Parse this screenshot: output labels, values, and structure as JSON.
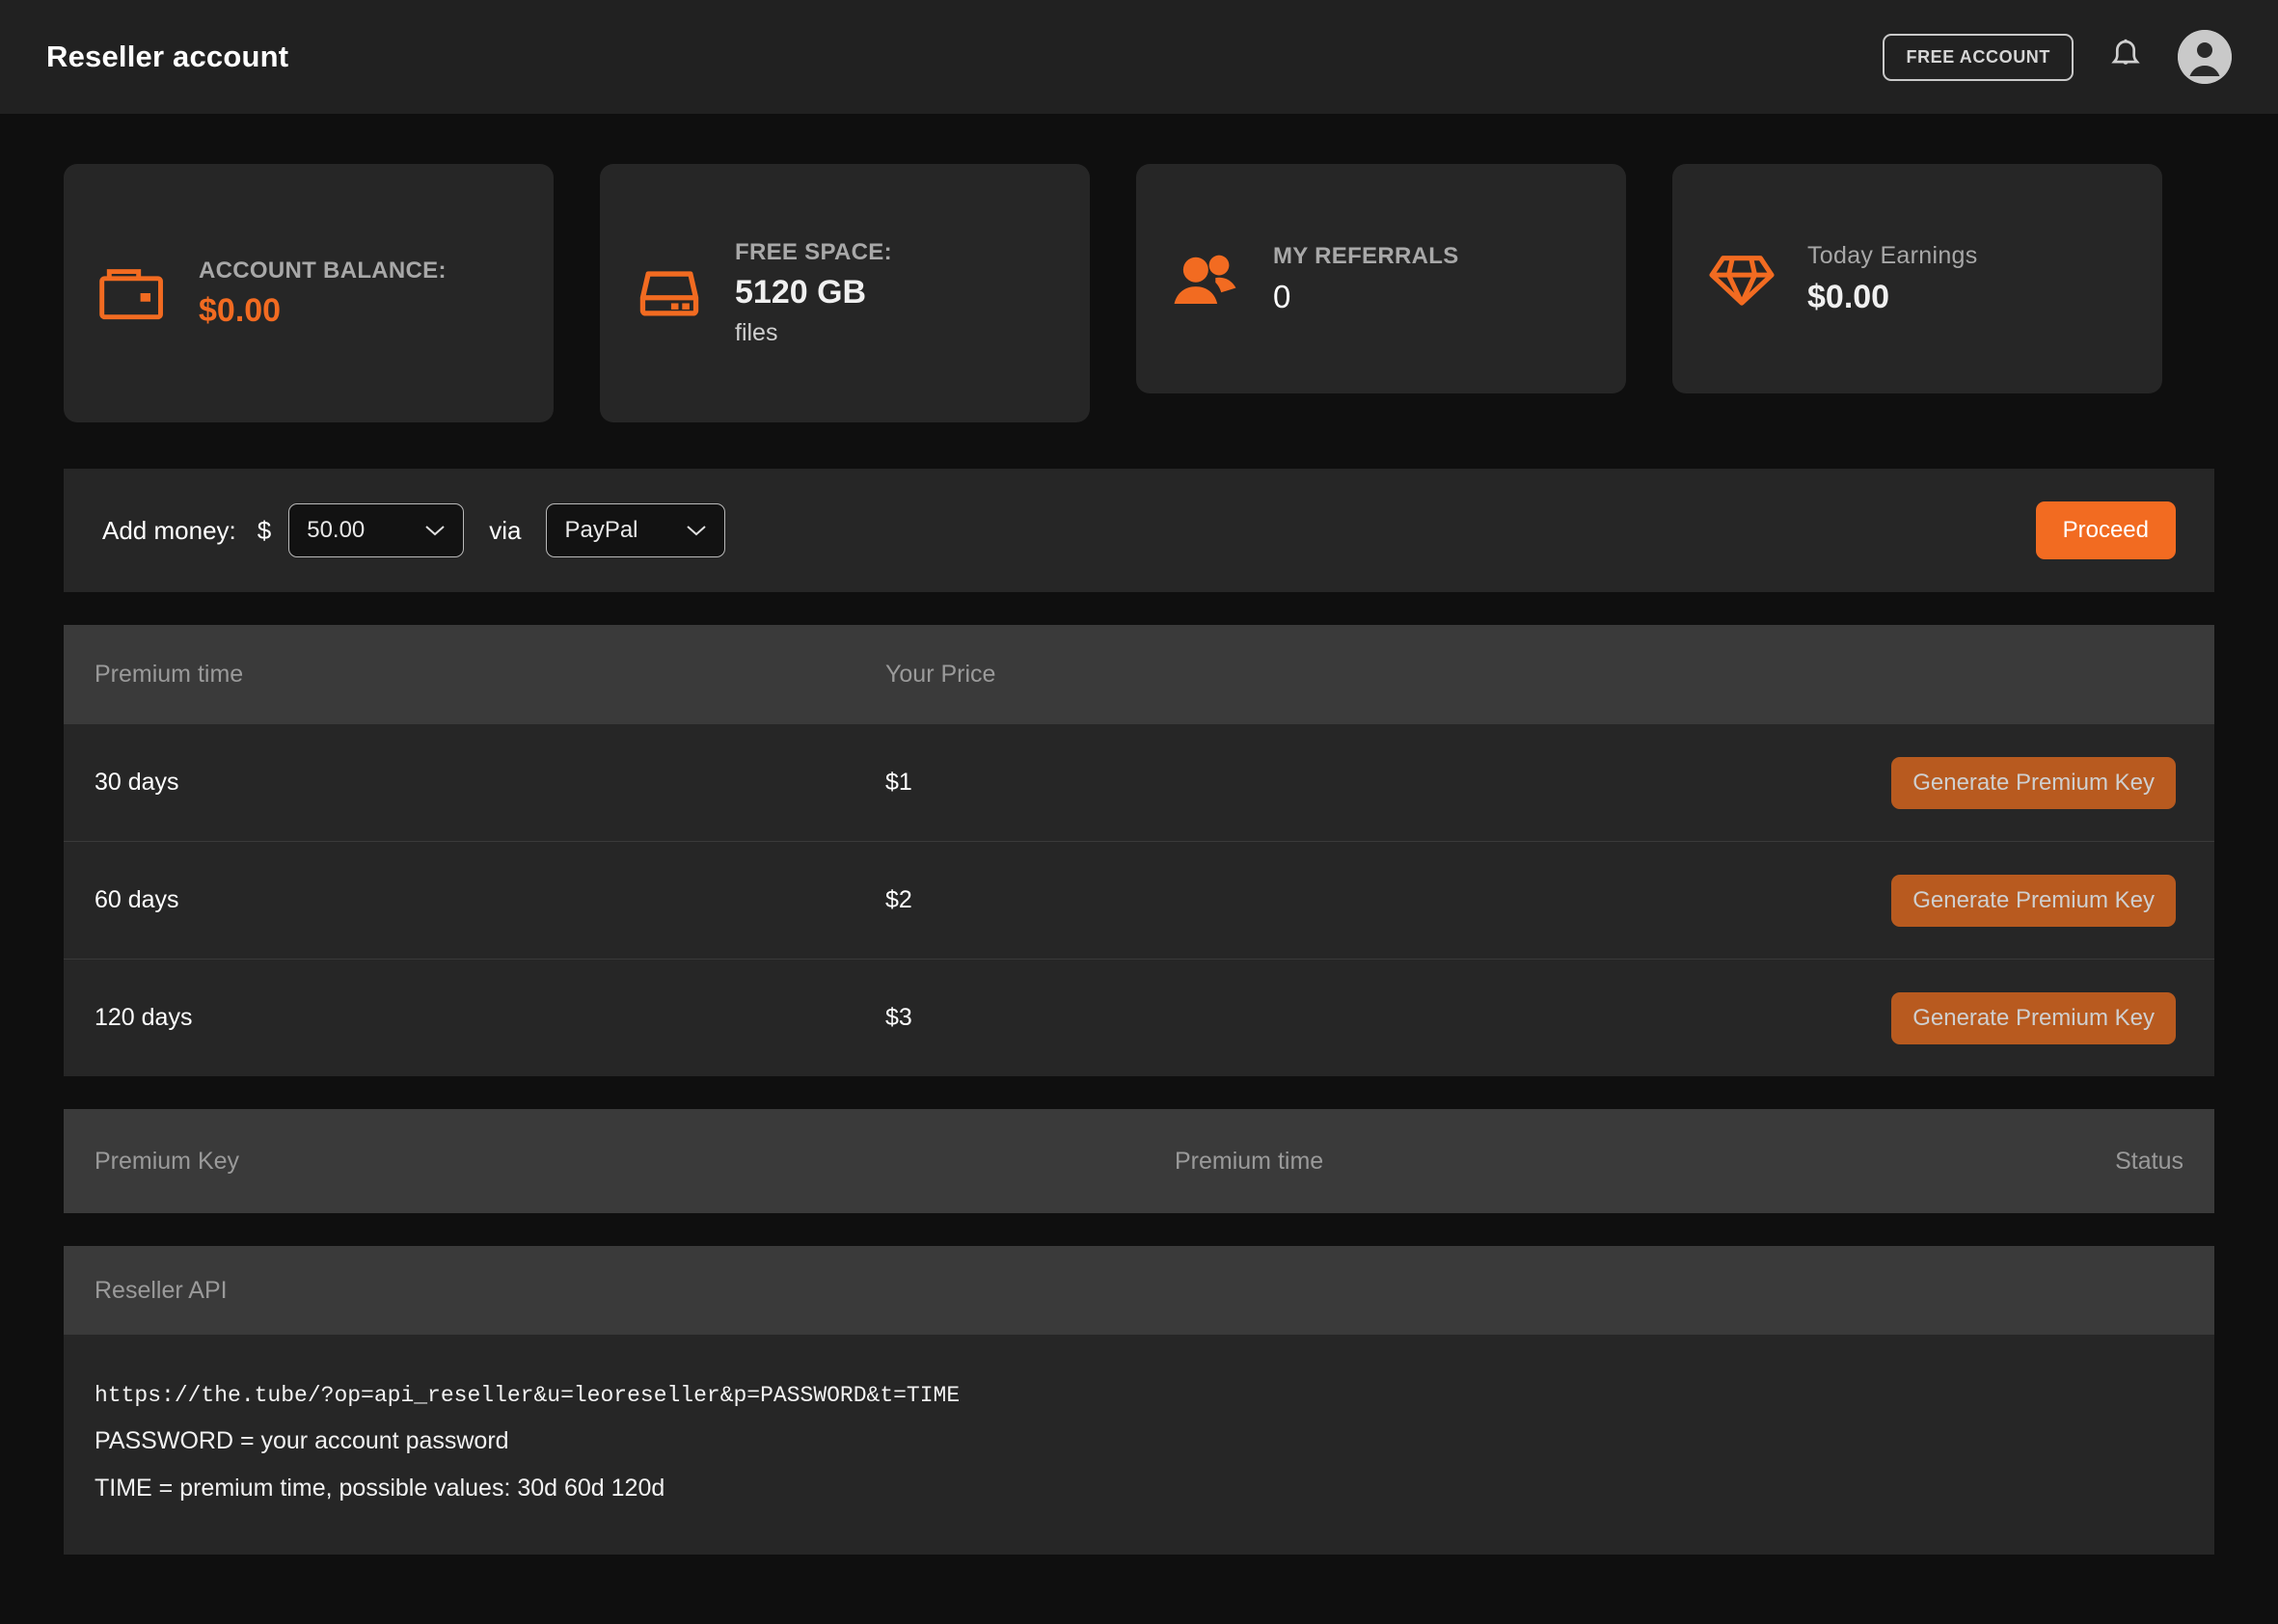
{
  "header": {
    "title": "Reseller account",
    "free_account_label": "FREE ACCOUNT",
    "notifications_icon": "bell-icon",
    "avatar_icon": "user-avatar-icon"
  },
  "stats": [
    {
      "icon": "wallet-icon",
      "label": "ACCOUNT BALANCE:",
      "value": "$0.00",
      "sub": ""
    },
    {
      "icon": "hard-drive-icon",
      "label": "FREE SPACE:",
      "value": "5120 GB",
      "sub": "files"
    },
    {
      "icon": "users-icon",
      "label": "MY REFERRALS",
      "value": "0",
      "sub": ""
    },
    {
      "icon": "diamond-icon",
      "label": "Today Earnings",
      "value": "$0.00",
      "sub": ""
    }
  ],
  "add_money": {
    "label": "Add money:",
    "currency_symbol": "$",
    "amount_selected": "50.00",
    "via_label": "via",
    "method_selected": "PayPal",
    "proceed_label": "Proceed"
  },
  "pricing_table": {
    "headers": {
      "time": "Premium time",
      "price": "Your Price",
      "action": ""
    },
    "rows": [
      {
        "time": "30 days",
        "price": "$1",
        "action_label": "Generate Premium Key"
      },
      {
        "time": "60 days",
        "price": "$2",
        "action_label": "Generate Premium Key"
      },
      {
        "time": "120 days",
        "price": "$3",
        "action_label": "Generate Premium Key"
      }
    ]
  },
  "keys_table": {
    "headers": {
      "key": "Premium Key",
      "time": "Premium time",
      "status": "Status"
    },
    "rows": []
  },
  "reseller_api": {
    "title": "Reseller API",
    "url": "https://the.tube/?op=api_reseller&u=leoreseller&p=PASSWORD&t=TIME",
    "line_password": "PASSWORD = your account password",
    "line_time": "TIME = premium time, possible values: 30d 60d 120d"
  },
  "colors": {
    "accent_orange": "#f26b21",
    "muted_orange": "#b85a1f",
    "page_bg": "#0f0f0f",
    "card_bg": "#262626",
    "header_bg": "#212121",
    "table_header_bg": "#3a3a3a"
  }
}
